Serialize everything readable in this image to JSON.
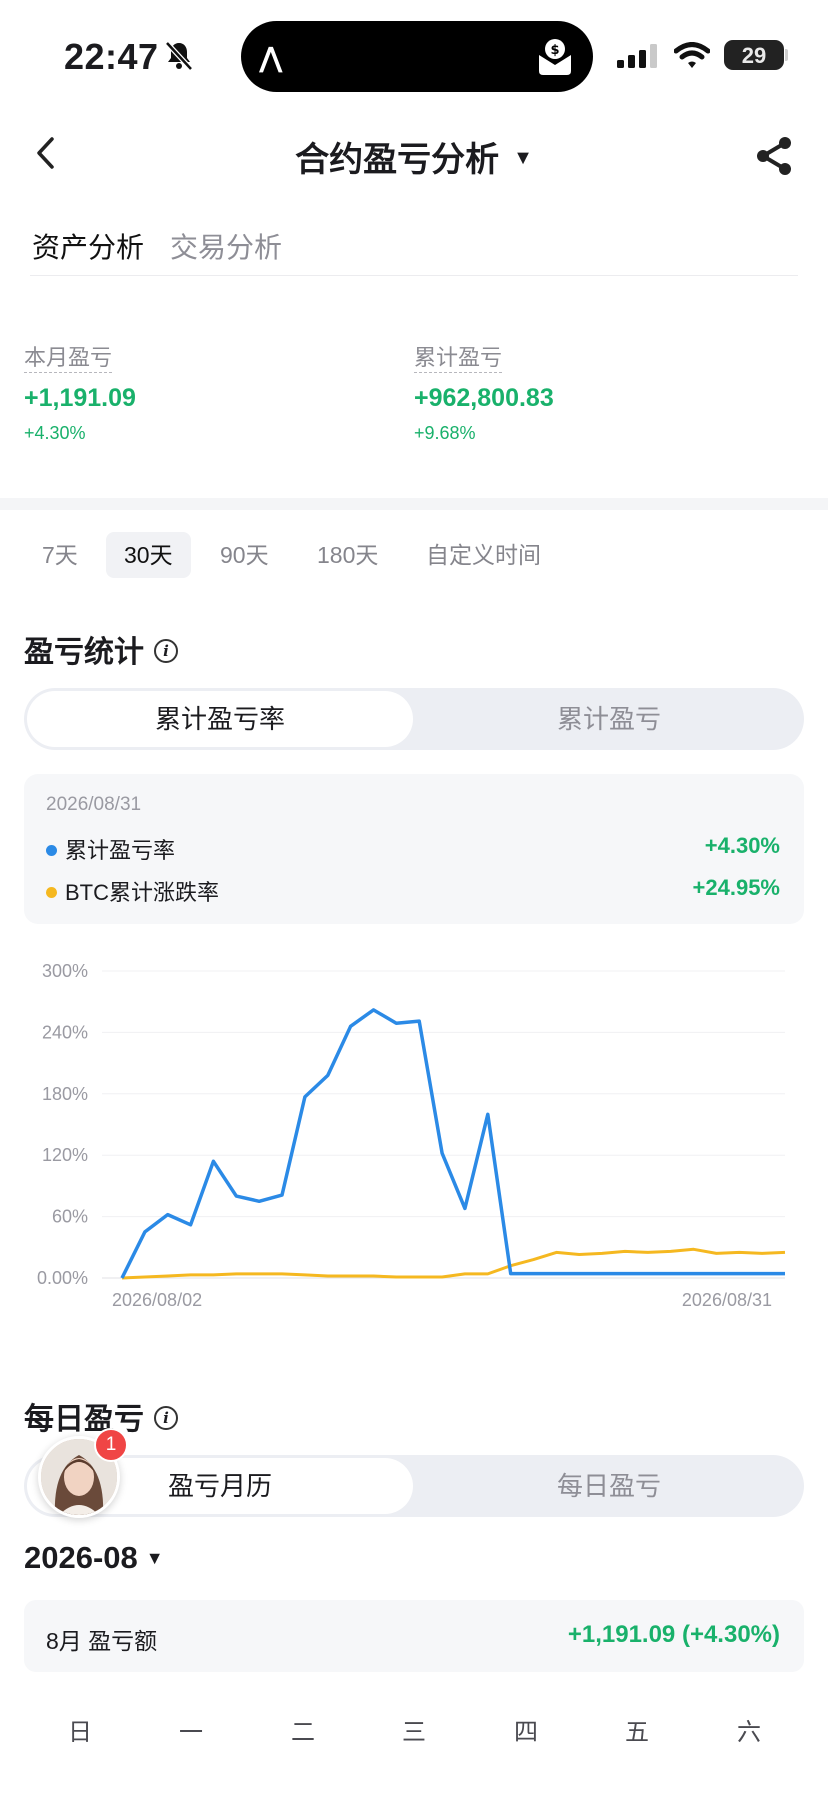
{
  "status_bar": {
    "time": "22:47",
    "battery": "29"
  },
  "header": {
    "title": "合约盈亏分析"
  },
  "top_tabs": [
    {
      "label": "资产分析"
    },
    {
      "label": "交易分析"
    }
  ],
  "stats": {
    "month": {
      "label": "本月盈亏",
      "value": "+1,191.09",
      "pct": "+4.30%"
    },
    "total": {
      "label": "累计盈亏",
      "value": "+962,800.83",
      "pct": "+9.68%"
    }
  },
  "periods": [
    {
      "label": "7天"
    },
    {
      "label": "30天"
    },
    {
      "label": "90天"
    },
    {
      "label": "180天"
    },
    {
      "label": "自定义时间"
    }
  ],
  "pnl_stats": {
    "title": "盈亏统计",
    "segments": [
      {
        "label": "累计盈亏率"
      },
      {
        "label": "累计盈亏"
      }
    ],
    "tooltip": {
      "date": "2026/08/31",
      "rows": [
        {
          "label": "累计盈亏率",
          "value": "+4.30%",
          "color": "#2b8ae6"
        },
        {
          "label": "BTC累计涨跌率",
          "value": "+24.95%",
          "color": "#f5b820"
        }
      ]
    }
  },
  "chart_data": {
    "type": "line",
    "x_start_label": "2026/08/02",
    "x_end_label": "2026/08/31",
    "y_ticks": [
      "300%",
      "240%",
      "180%",
      "120%",
      "60%",
      "0.00%"
    ],
    "ylim": [
      0,
      300
    ],
    "series": [
      {
        "name": "累计盈亏率",
        "color": "#2b8ae6",
        "values": [
          0,
          45,
          62,
          52,
          114,
          80,
          75,
          81,
          177,
          198,
          246,
          262,
          249,
          251,
          122,
          68,
          160,
          4.3,
          4.3,
          4.3,
          4.3,
          4.3,
          4.3,
          4.3,
          4.3,
          4.3,
          4.3,
          4.3,
          4.3,
          4.3
        ]
      },
      {
        "name": "BTC累计涨跌率",
        "color": "#f5b820",
        "values": [
          0,
          1,
          2,
          3,
          3,
          4,
          4,
          4,
          3,
          2,
          2,
          2,
          1,
          1,
          1,
          4,
          4,
          12,
          18,
          25,
          23,
          24,
          26,
          25,
          26,
          28,
          24,
          25,
          24,
          25
        ]
      }
    ]
  },
  "daily": {
    "title": "每日盈亏",
    "segments": [
      {
        "label": "盈亏月历"
      },
      {
        "label": "每日盈亏"
      }
    ],
    "badge_count": "1",
    "month": "2026-08",
    "summary_label": "8月 盈亏额",
    "summary_value": "+1,191.09 (+4.30%)",
    "weekdays": [
      "日",
      "一",
      "二",
      "三",
      "四",
      "五",
      "六"
    ]
  }
}
